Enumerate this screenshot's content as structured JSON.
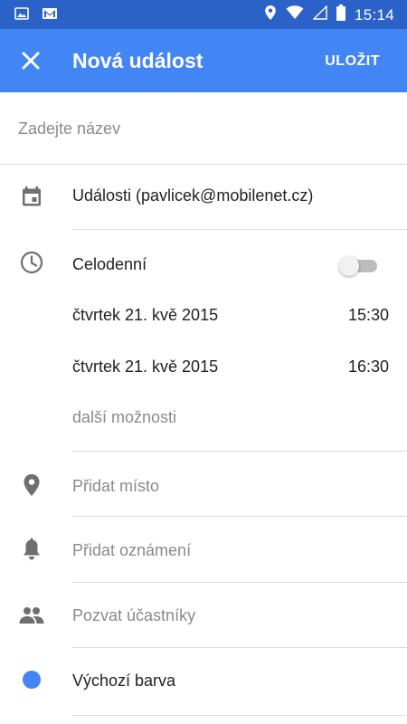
{
  "statusbar": {
    "time": "15:14"
  },
  "appbar": {
    "title": "Nová událost",
    "save_label": "ULOŽIT"
  },
  "form": {
    "title_placeholder": "Zadejte název",
    "title_value": "",
    "calendar": "Události (pavlicek@mobilenet.cz)",
    "all_day_label": "Celodenní",
    "all_day_on": false,
    "start_date": "čtvrtek 21. kvě 2015",
    "start_time": "15:30",
    "end_date": "čtvrtek 21. kvě 2015",
    "end_time": "16:30",
    "more_options": "další možnosti",
    "location_placeholder": "Přidat místo",
    "notification_placeholder": "Přidat oznámení",
    "guests_placeholder": "Pozvat účastníky",
    "color_label": "Výchozí barva",
    "color_value": "#4285f4"
  },
  "colors": {
    "status_bar": "#2a62c8",
    "app_bar": "#4285f4",
    "icon_gray": "#6f6f6f"
  }
}
